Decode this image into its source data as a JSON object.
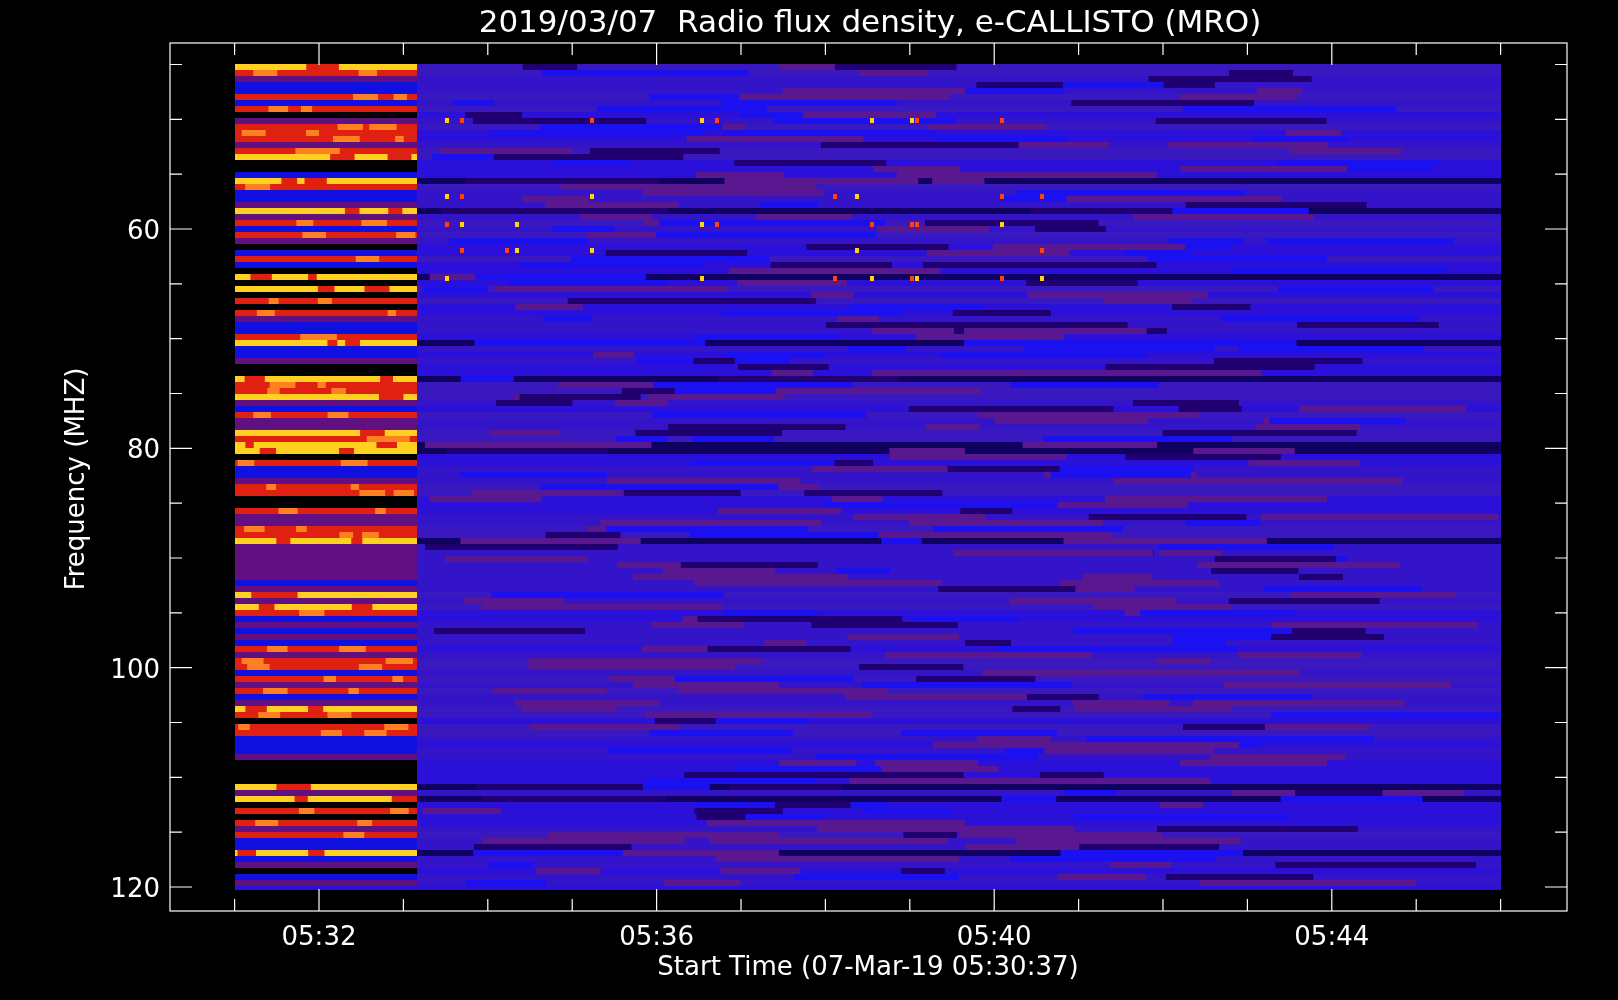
{
  "title": "2019/03/07  Radio flux density, e-CALLISTO (MRO)",
  "plot": {
    "y_axis": {
      "label": "Frequency (MHZ)",
      "ticks": [
        "60",
        "80",
        "100",
        "120"
      ]
    },
    "x_axis": {
      "label": "Start Time (07-Mar-19 05:30:37)",
      "ticks": [
        "05:32",
        "05:36",
        "05:40",
        "05:44"
      ]
    }
  }
}
